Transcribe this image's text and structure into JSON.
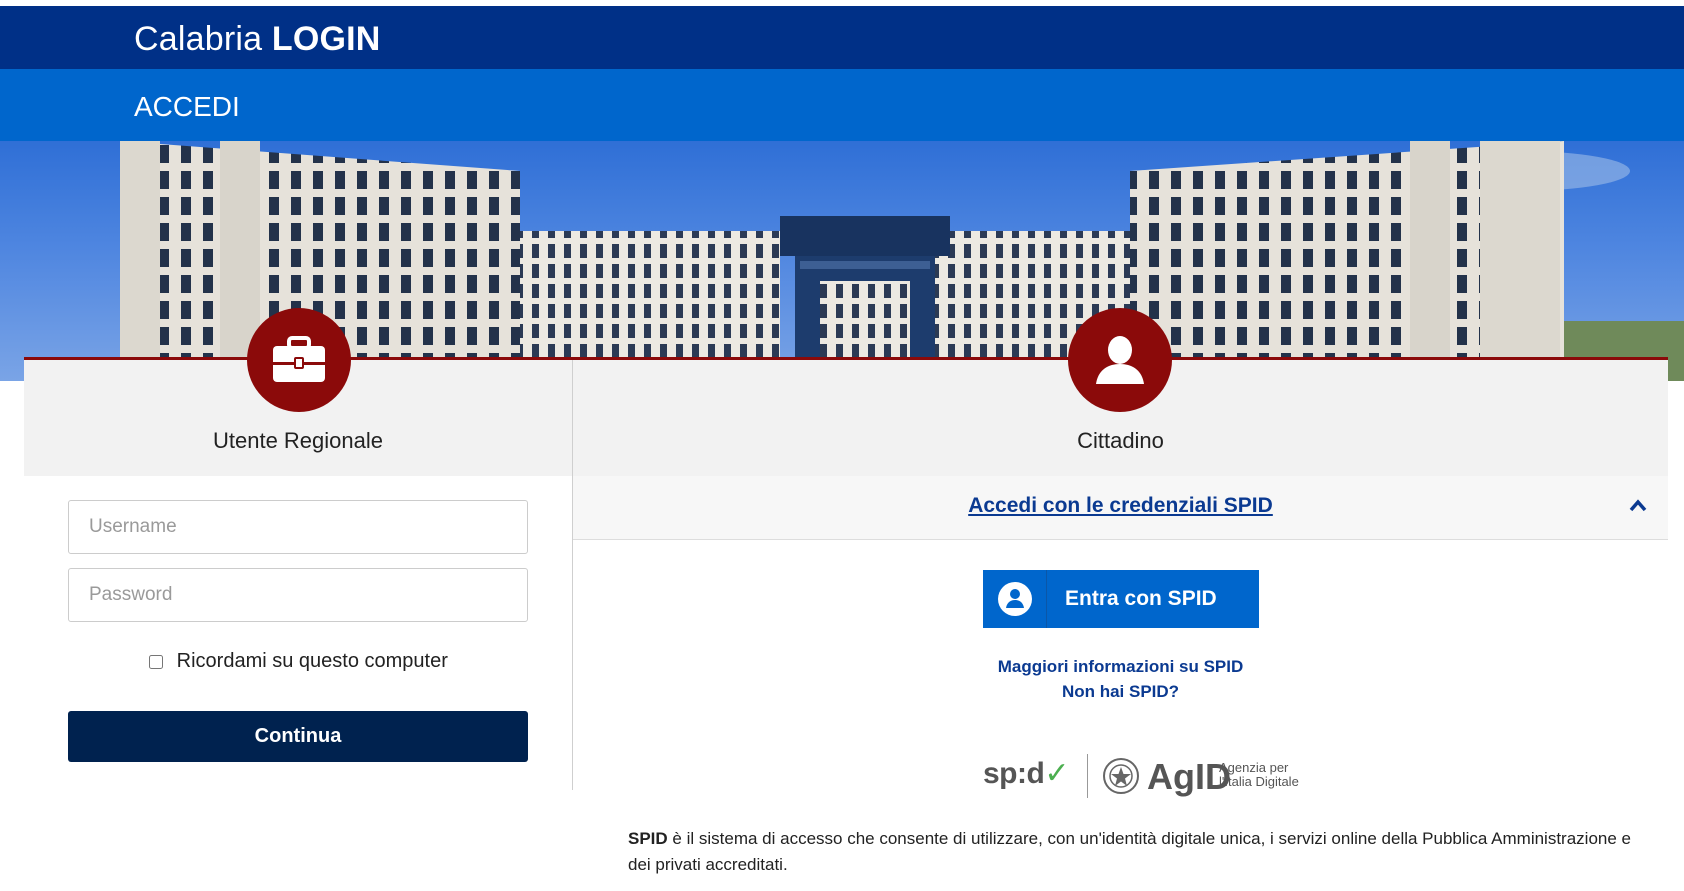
{
  "header": {
    "brand_light": "Calabria",
    "brand_bold": "LOGIN",
    "nav_label": "ACCEDI"
  },
  "regional": {
    "title": "Utente Regionale",
    "username_placeholder": "Username",
    "password_placeholder": "Password",
    "remember_label": "Ricordami su questo computer",
    "continue_label": "Continua"
  },
  "citizen": {
    "title": "Cittadino",
    "spid_section_link": "Accedi con le credenziali SPID",
    "spid_button_label": "Entra con SPID",
    "more_info_link": "Maggiori informazioni su SPID",
    "no_spid_link": "Non hai SPID?",
    "logo_spid": "sp:d",
    "logo_agid": "AgID",
    "logo_agid_line1": "Agenzia per",
    "logo_agid_line2": "l'Italia Digitale",
    "description_bold": "SPID",
    "description_rest": " è il sistema di accesso che consente di utilizzare, con un'identità digitale unica, i servizi online della Pubblica Amministrazione e dei privati accreditati."
  },
  "colors": {
    "header_dark": "#003087",
    "header_blue": "#0066cc",
    "accent_red": "#8b0a0a",
    "continue_button": "#00224f"
  },
  "icons": [
    "briefcase-icon",
    "user-icon",
    "chevron-up-icon",
    "spid-user-icon",
    "emblem-icon"
  ]
}
